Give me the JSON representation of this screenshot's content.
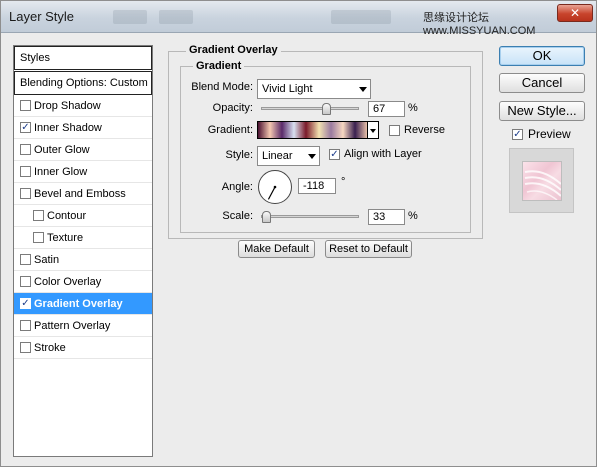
{
  "window": {
    "title": "Layer Style",
    "watermark": "思缘设计论坛  www.MISSYUAN.COM",
    "close_glyph": "✕"
  },
  "left_panel": {
    "styles_label": "Styles",
    "blending_label": "Blending Options: Custom",
    "items": [
      {
        "label": "Drop Shadow",
        "checked": false
      },
      {
        "label": "Inner Shadow",
        "checked": true
      },
      {
        "label": "Outer Glow",
        "checked": false
      },
      {
        "label": "Inner Glow",
        "checked": false
      },
      {
        "label": "Bevel and Emboss",
        "checked": false
      },
      {
        "label": "Contour",
        "checked": false
      },
      {
        "label": "Texture",
        "checked": false
      },
      {
        "label": "Satin",
        "checked": false
      },
      {
        "label": "Color Overlay",
        "checked": false
      },
      {
        "label": "Gradient Overlay",
        "checked": true,
        "selected": true
      },
      {
        "label": "Pattern Overlay",
        "checked": false
      },
      {
        "label": "Stroke",
        "checked": false
      }
    ]
  },
  "gradient_overlay": {
    "section_title": "Gradient Overlay",
    "group_title": "Gradient",
    "blend_mode_label": "Blend Mode:",
    "blend_mode_value": "Vivid Light",
    "opacity_label": "Opacity:",
    "opacity_value": "67",
    "opacity_unit": "%",
    "opacity_fraction": 0.67,
    "gradient_label": "Gradient:",
    "gradient_colors": [
      "#4a1030",
      "#f4c8b0",
      "#5a2a6a",
      "#d8e0f0",
      "#7a1a2a",
      "#f2e2b0",
      "#9a7aa0",
      "#f8d8c0",
      "#3a2050",
      "#e8c0a8"
    ],
    "reverse_label": "Reverse",
    "reverse_checked": false,
    "style_label": "Style:",
    "style_value": "Linear",
    "align_label": "Align with Layer",
    "align_checked": true,
    "angle_label": "Angle:",
    "angle_value": "-118",
    "angle_unit": "°",
    "scale_label": "Scale:",
    "scale_value": "33",
    "scale_unit": "%",
    "scale_fraction": 0.06,
    "make_default_label": "Make Default",
    "reset_default_label": "Reset to Default"
  },
  "right_buttons": {
    "ok_label": "OK",
    "cancel_label": "Cancel",
    "new_style_label": "New Style...",
    "preview_label": "Preview",
    "preview_checked": true
  },
  "colors": {
    "selection": "#3399ff",
    "dialog_bg": "#ececec"
  }
}
